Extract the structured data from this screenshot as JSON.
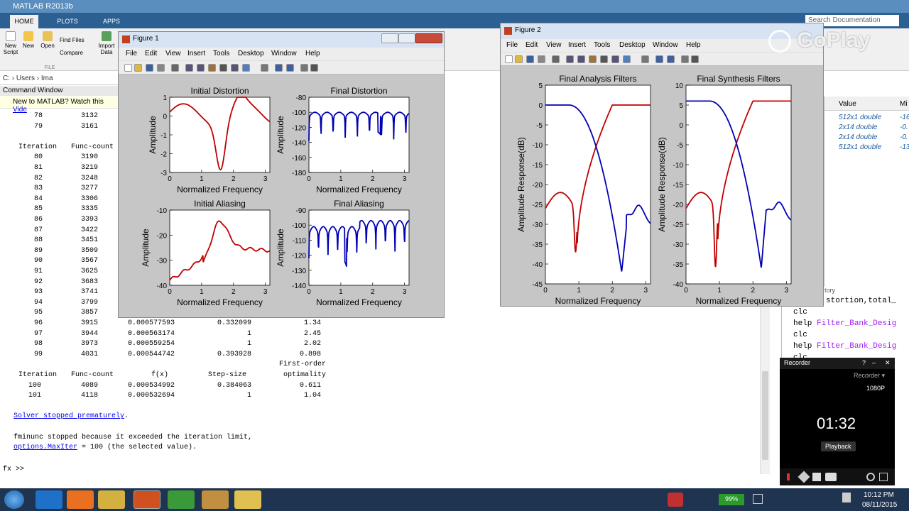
{
  "app_title": "MATLAB R2013b",
  "ribbon": {
    "tabs": [
      "HOME",
      "PLOTS",
      "APPS"
    ],
    "search_placeholder": "Search Documentation",
    "buttons": [
      "New Script",
      "New",
      "Open",
      "Find Files",
      "Compare",
      "Import Data"
    ],
    "group_label": "FILE"
  },
  "address": {
    "path": "C: › Users › Ima"
  },
  "command_window": {
    "header": "Command Window",
    "notice_prefix": "New to MATLAB? Watch this ",
    "notice_link": "Vide",
    "rows_top": [
      [
        "78",
        "3132"
      ],
      [
        "79",
        "3161"
      ]
    ],
    "header_iter": "Iteration",
    "header_func": "Func-count",
    "rows_mid": [
      [
        "80",
        "3190"
      ],
      [
        "81",
        "3219"
      ],
      [
        "82",
        "3248"
      ],
      [
        "83",
        "3277"
      ],
      [
        "84",
        "3306"
      ],
      [
        "85",
        "3335"
      ],
      [
        "86",
        "3393"
      ],
      [
        "87",
        "3422"
      ],
      [
        "88",
        "3451"
      ],
      [
        "89",
        "3509"
      ],
      [
        "90",
        "3567"
      ],
      [
        "91",
        "3625"
      ],
      [
        "92",
        "3683"
      ],
      [
        "93",
        "3741"
      ],
      [
        "94",
        "3799"
      ],
      [
        "95",
        "3857"
      ]
    ],
    "rows_full": [
      [
        "96",
        "3915",
        "0.000577593",
        "0.332099",
        "1.34"
      ],
      [
        "97",
        "3944",
        "0.000563174",
        "1",
        "2.45"
      ],
      [
        "98",
        "3973",
        "0.000559254",
        "1",
        "2.02"
      ],
      [
        "99",
        "4031",
        "0.000544742",
        "0.393928",
        "0.898"
      ]
    ],
    "first_order": "First-order",
    "header2": [
      "Iteration",
      "Func-count",
      "f(x)",
      "Step-size",
      "optimality"
    ],
    "rows_last": [
      [
        "100",
        "4089",
        "0.000534992",
        "0.384063",
        "0.611"
      ],
      [
        "101",
        "4118",
        "0.000532694",
        "1",
        "1.04"
      ]
    ],
    "solver_msg": "Solver stopped prematurely",
    "fminunc_msg": "fminunc stopped because it exceeded the iteration limit,",
    "maxiter_link": "options.MaxIter",
    "maxiter_rest": " = 100 (the selected value).",
    "prompt": "fx >>"
  },
  "workspace": {
    "header_value": "Value",
    "header_min": "Mi",
    "values": [
      "512x1 double",
      "2x14 double",
      "2x14 double",
      "512x1 double"
    ],
    "mins": [
      "-16",
      "-0.",
      "-0.",
      "-13"
    ]
  },
  "history": {
    "label": "tory",
    "top_line": "stortion,total_",
    "items": [
      "clc",
      "help Filter_Bank_Desig",
      "clc",
      "help Filter_Bank_Desig",
      "clc"
    ]
  },
  "figure1": {
    "title": "Figure 1",
    "menu": [
      "File",
      "Edit",
      "View",
      "Insert",
      "Tools",
      "Desktop",
      "Window",
      "Help"
    ],
    "plots": [
      {
        "title": "Initial Distortion",
        "ylabel": "Amplitude",
        "xlabel": "Normalized Frequency",
        "yticks": [
          "1",
          "0",
          "-1",
          "-2",
          "-3"
        ],
        "xticks": [
          "0",
          "1",
          "2",
          "3"
        ]
      },
      {
        "title": "Final Distortion",
        "ylabel": "Amplitude",
        "xlabel": "Normalized Frequency",
        "yticks": [
          "-80",
          "-100",
          "-120",
          "-140",
          "-160",
          "-180"
        ],
        "xticks": [
          "0",
          "1",
          "2",
          "3"
        ]
      },
      {
        "title": "Initial Aliasing",
        "ylabel": "Amplitude",
        "xlabel": "Normalized Frequency",
        "yticks": [
          "-10",
          "-20",
          "-30",
          "-40"
        ],
        "xticks": [
          "0",
          "1",
          "2",
          "3"
        ]
      },
      {
        "title": "Final Aliasing",
        "ylabel": "Amplitude",
        "xlabel": "Normalized Frequency",
        "yticks": [
          "-90",
          "-100",
          "-110",
          "-120",
          "-130",
          "-140"
        ],
        "xticks": [
          "0",
          "1",
          "2",
          "3"
        ]
      }
    ]
  },
  "figure2": {
    "title": "Figure 2",
    "menu": [
      "File",
      "Edit",
      "View",
      "Insert",
      "Tools",
      "Desktop",
      "Window",
      "Help"
    ],
    "plots": [
      {
        "title": "Final Analysis Filters",
        "ylabel": "Amplitude Response(dB)",
        "xlabel": "Normalized Frequency",
        "yticks": [
          "5",
          "0",
          "-5",
          "-10",
          "-15",
          "-20",
          "-25",
          "-30",
          "-35",
          "-40",
          "-45"
        ],
        "xticks": [
          "0",
          "1",
          "2",
          "3"
        ]
      },
      {
        "title": "Final Synthesis Filters",
        "ylabel": "Amplitude Response(dB)",
        "xlabel": "Normalized Frequency",
        "yticks": [
          "10",
          "5",
          "0",
          "-5",
          "-10",
          "-15",
          "-20",
          "-25",
          "-30",
          "-35",
          "-40"
        ],
        "xticks": [
          "0",
          "1",
          "2",
          "3"
        ]
      }
    ]
  },
  "watermark": "GoPlay",
  "recorder": {
    "title": "Recorder",
    "dropdown": "Recorder",
    "resolution": "1080P",
    "time": "01:32",
    "playback": "Playback"
  },
  "taskbar": {
    "battery": "99%",
    "time": "10:12 PM",
    "date": "08/11/2015"
  },
  "colors": {
    "red": "#c00000",
    "blue": "#0000b4",
    "titlebar": "#5a8ebf"
  }
}
